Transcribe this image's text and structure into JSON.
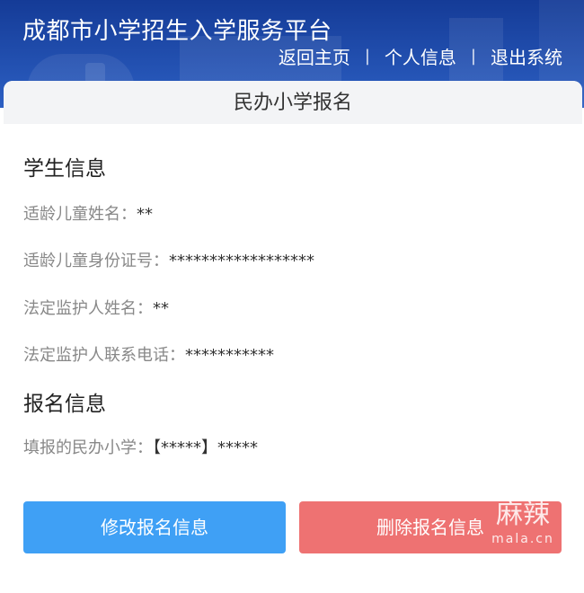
{
  "header": {
    "title": "成都市小学招生入学服务平台",
    "nav": {
      "home": "返回主页",
      "sep1": "|",
      "profile": "个人信息",
      "sep2": "|",
      "logout": "退出系统"
    }
  },
  "page": {
    "heading": "民办小学报名"
  },
  "student": {
    "section_title": "学生信息",
    "child_name_label": "适龄儿童姓名：",
    "child_name_value": "**",
    "child_id_label": "适龄儿童身份证号：",
    "child_id_value": "******************",
    "guardian_name_label": "法定监护人姓名：",
    "guardian_name_value": "**",
    "guardian_phone_label": "法定监护人联系电话：",
    "guardian_phone_value": "***********"
  },
  "registration": {
    "section_title": "报名信息",
    "school_label": "填报的民办小学：",
    "school_value": "【*****】*****"
  },
  "actions": {
    "edit": "修改报名信息",
    "delete": "删除报名信息"
  },
  "watermark": {
    "big": "麻辣",
    "small": "mala.cn"
  },
  "colors": {
    "header_bg": "#1c4ea6",
    "edit_button": "#3fa0f5",
    "delete_button": "#ee7272"
  }
}
